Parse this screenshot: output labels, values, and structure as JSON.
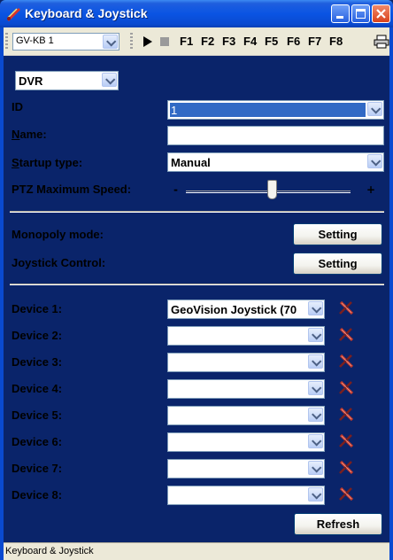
{
  "window": {
    "title": "Keyboard & Joystick"
  },
  "toolbar": {
    "keyboard_select": "GV-KB 1",
    "fkeys": [
      "F1",
      "F2",
      "F3",
      "F4",
      "F5",
      "F6",
      "F7",
      "F8"
    ]
  },
  "form": {
    "mode_select": "DVR",
    "id_label": "ID",
    "id_value": "1",
    "name_label_prefix": "N",
    "name_label_rest": "ame:",
    "name_value": "",
    "startup_label_prefix": "S",
    "startup_label_rest": "tartup type:",
    "startup_value": "Manual",
    "ptz_label": "PTZ Maximum Speed:",
    "ptz_minus": "-",
    "ptz_plus": "+",
    "ptz_speed_fraction": 0.52,
    "monopoly_label": "Monopoly mode:",
    "monopoly_button": "Setting",
    "joystick_label": "Joystick Control:",
    "joystick_button": "Setting"
  },
  "devices": [
    {
      "label": "Device 1:",
      "value": "GeoVision Joystick (70"
    },
    {
      "label": "Device 2:",
      "value": ""
    },
    {
      "label": "Device 3:",
      "value": ""
    },
    {
      "label": "Device 4:",
      "value": ""
    },
    {
      "label": "Device 5:",
      "value": ""
    },
    {
      "label": "Device 6:",
      "value": ""
    },
    {
      "label": "Device 7:",
      "value": ""
    },
    {
      "label": "Device 8:",
      "value": ""
    }
  ],
  "refresh_button": "Refresh",
  "status_text": "Keyboard & Joystick",
  "colors": {
    "titlebar": "#0a54e3",
    "selection": "#316ac5",
    "remove_icon": "#c0392b"
  },
  "icons": {
    "title": "keyboard-joystick-icon",
    "play": "play-icon",
    "stop": "stop-icon",
    "print": "printer-icon",
    "remove": "remove-device-icon"
  }
}
